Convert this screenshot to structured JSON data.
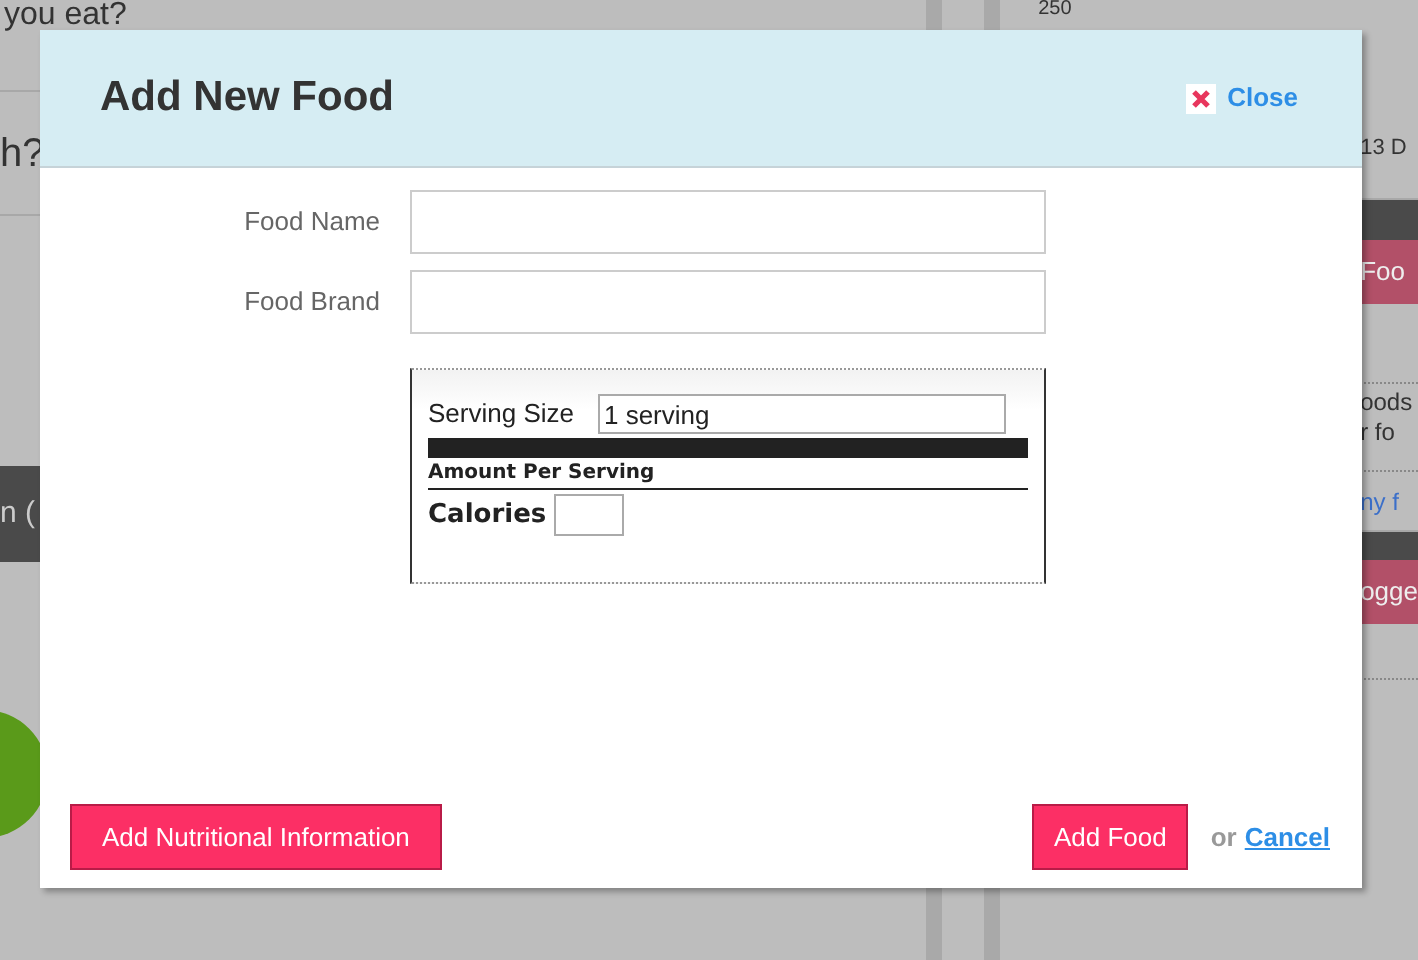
{
  "background": {
    "left_texts": [
      "you eat?",
      "h?",
      "n ("
    ],
    "right_texts": [
      "250",
      "13 D"
    ],
    "right_buttons": [
      "Foo",
      "ogge"
    ],
    "right_note": [
      "oods",
      "r fo"
    ],
    "right_link": "ny f"
  },
  "dialog": {
    "title": "Add New Food",
    "close": "Close",
    "fields": [
      {
        "label": "Food Name"
      },
      {
        "label": "Food Brand"
      }
    ],
    "nutrition": {
      "serving_label": "Serving Size",
      "serving_value": "1 serving",
      "amount_heading": "Amount Per Serving",
      "calories_label": "Calories"
    },
    "add_info_button": "Add Nutritional Information",
    "add_button": "Add Food",
    "or": "or",
    "cancel": "Cancel"
  }
}
